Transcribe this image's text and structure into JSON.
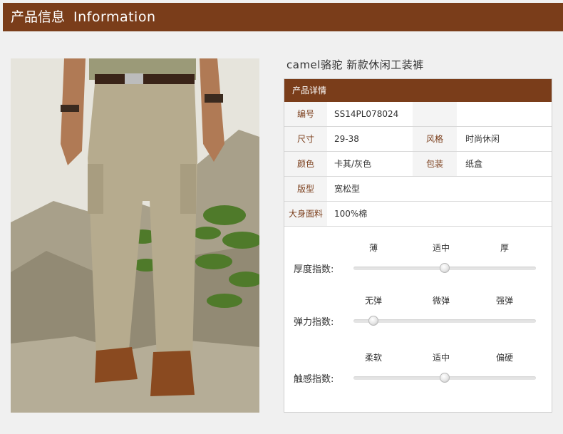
{
  "header": {
    "title_cn": "产品信息",
    "title_en": "Information"
  },
  "product": {
    "name": "camel骆驼 新款休闲工装裤"
  },
  "details": {
    "heading": "产品详情",
    "rows": [
      {
        "label": "编号",
        "value": "SS14PL078024",
        "label2": "",
        "value2": ""
      },
      {
        "label": "尺寸",
        "value": "29-38",
        "label2": "风格",
        "value2": "时尚休闲"
      },
      {
        "label": "颜色",
        "value": "卡其/灰色",
        "label2": "包装",
        "value2": "纸盒"
      },
      {
        "label": "版型",
        "value": "宽松型"
      },
      {
        "label": "大身面料",
        "value": "100%棉"
      }
    ]
  },
  "indices": [
    {
      "label": "厚度指数:",
      "scale": [
        "薄",
        "适中",
        "厚"
      ],
      "level": 0.5
    },
    {
      "label": "弹力指数:",
      "scale": [
        "无弹",
        "微弹",
        "强弹"
      ],
      "level": 0.11
    },
    {
      "label": "触感指数:",
      "scale": [
        "柔软",
        "适中",
        "偏硬"
      ],
      "level": 0.5
    }
  ],
  "colors": {
    "brand": "#7a3d1a"
  }
}
